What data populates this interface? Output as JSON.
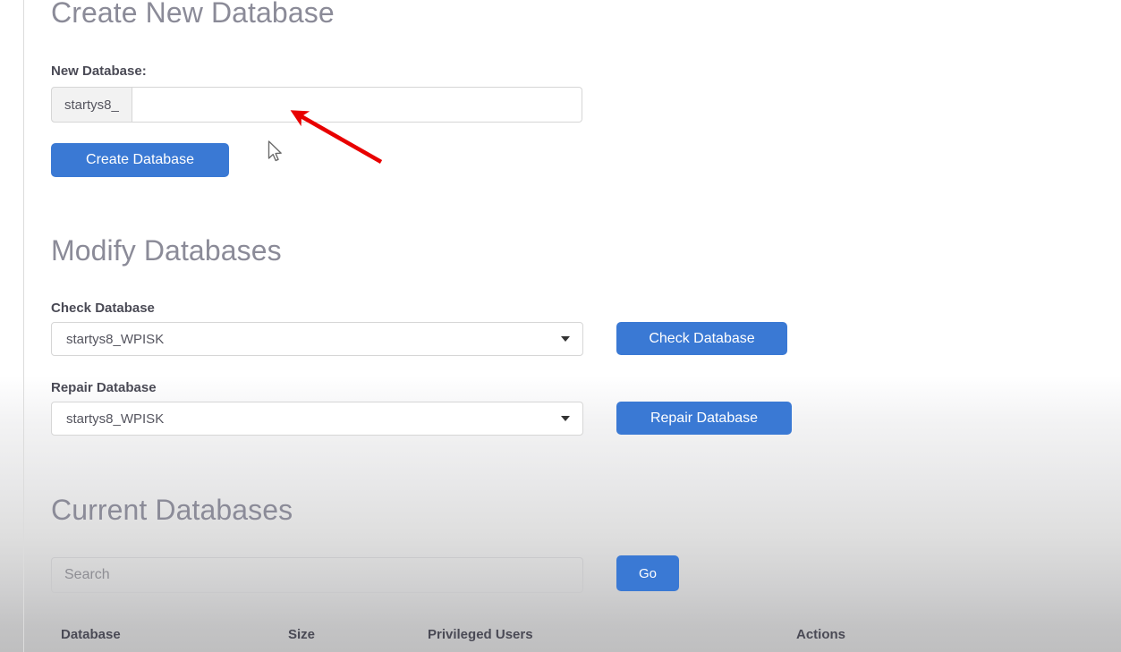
{
  "page": {
    "sections": {
      "create": {
        "heading": "Create New Database",
        "field_label": "New Database:",
        "prefix": "startys8_",
        "input_value": "",
        "input_placeholder": "",
        "submit_label": "Create Database"
      },
      "modify": {
        "heading": "Modify Databases",
        "check": {
          "label": "Check Database",
          "selected": "startys8_WPISK",
          "button_label": "Check Database"
        },
        "repair": {
          "label": "Repair Database",
          "selected": "startys8_WPISK",
          "button_label": "Repair Database"
        }
      },
      "current": {
        "heading": "Current Databases",
        "search_placeholder": "Search",
        "search_value": "",
        "go_label": "Go",
        "table_headers": {
          "database": "Database",
          "size": "Size",
          "privileged_users": "Privileged Users",
          "actions": "Actions"
        }
      }
    }
  },
  "annotations": {
    "arrow_color": "#e80000",
    "cursor_icon": "mouse-pointer-icon",
    "arrow_icon": "red-arrow-annotation-icon"
  },
  "colors": {
    "primary_button": "#3a79d4",
    "heading_text": "#8b8b98",
    "label_text": "#4a4a55",
    "border": "#d6d6d6"
  }
}
